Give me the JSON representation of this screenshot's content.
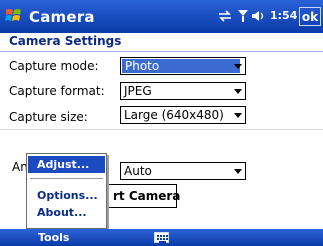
{
  "titlebar": {
    "app_title": "Camera",
    "time": "1:54",
    "ok_label": "ok",
    "icons": [
      "windows-start-icon",
      "sync-icon",
      "signal-icon",
      "volume-icon"
    ]
  },
  "settings": {
    "title": "Camera Settings",
    "capture_mode": {
      "label": "Capture mode:",
      "value": "Photo"
    },
    "capture_format": {
      "label": "Capture format:",
      "value": "JPEG"
    },
    "capture_size": {
      "label": "Capture size:",
      "value": "Large (640x480)"
    },
    "anti_flicker": {
      "label": "An",
      "value": "Auto"
    }
  },
  "start_button": {
    "label": "rt Camera"
  },
  "menu": {
    "items": [
      {
        "label": "Adjust...",
        "highlighted": true
      },
      {
        "label": "Options..."
      },
      {
        "label": "About..."
      }
    ]
  },
  "bottombar": {
    "tools_label": "Tools",
    "input_icon": "keyboard-icon"
  },
  "colors": {
    "titlebar": "#0b3aa8",
    "highlight": "#1c4bc0",
    "heading": "#0a2b85"
  }
}
